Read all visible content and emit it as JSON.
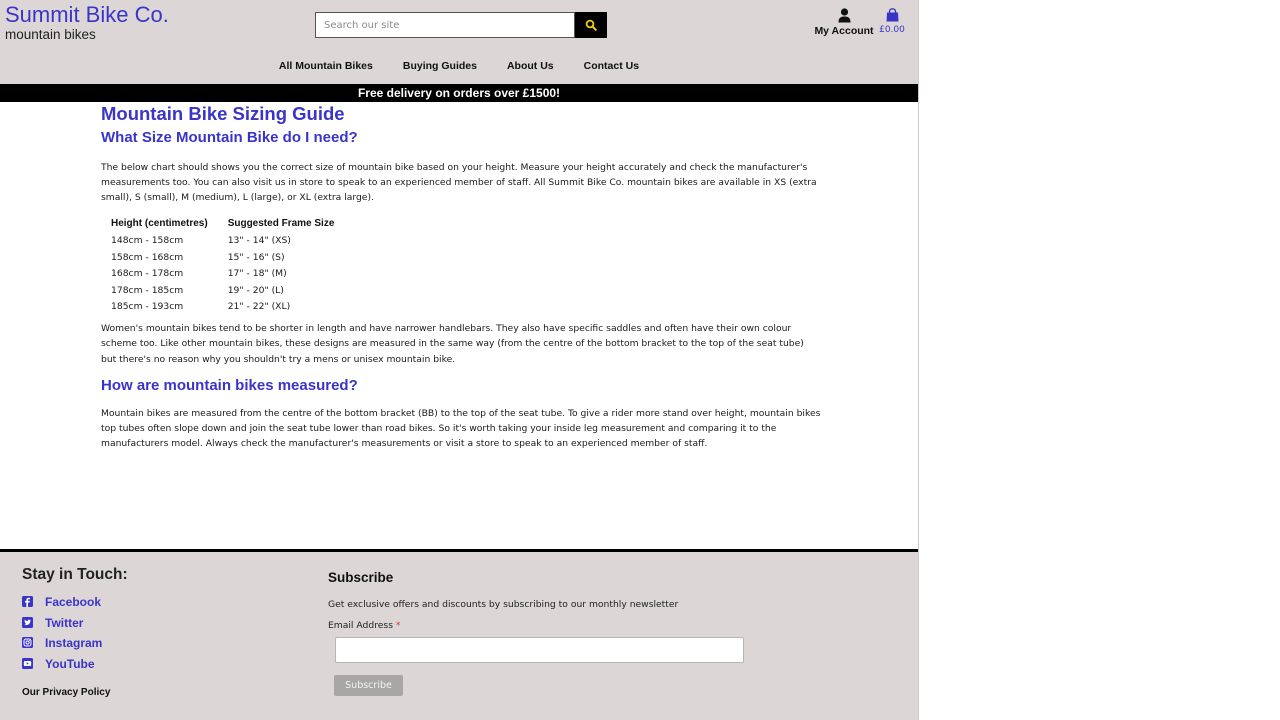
{
  "brand": {
    "name": "Summit Bike Co.",
    "tagline": "mountain bikes"
  },
  "search": {
    "placeholder": "Search our site",
    "button_icon": "search-icon"
  },
  "account": {
    "label": "My Account",
    "icon": "user-icon"
  },
  "cart": {
    "total": "£0.00",
    "icon": "shopping-bag-icon"
  },
  "nav": {
    "items": [
      "All Mountain Bikes",
      "Buying Guides",
      "About Us",
      "Contact Us"
    ]
  },
  "banner": {
    "text": "Free delivery on orders over £1500!"
  },
  "main": {
    "title": "Mountain Bike Sizing Guide",
    "section1_heading": "What Size Mountain Bike do I need?",
    "intro": "The below chart should shows you the correct size of mountain bike based on your height. Measure your height accurately and check the manufacturer's measurements too. You can also visit us in store to speak to an experienced member of staff. All Summit Bike Co. mountain bikes are available in XS (extra small), S (small), M (medium), L (large), or XL (extra large).",
    "table": {
      "headers": [
        "Height (centimetres)",
        "Suggested Frame Size"
      ],
      "rows": [
        [
          "148cm - 158cm",
          "13\" - 14\" (XS)"
        ],
        [
          "158cm - 168cm",
          "15\" - 16\" (S)"
        ],
        [
          "168cm - 178cm",
          "17\" - 18\" (M)"
        ],
        [
          "178cm - 185cm",
          "19\" - 20\" (L)"
        ],
        [
          "185cm - 193cm",
          "21\" - 22\" (XL)"
        ]
      ]
    },
    "womens": "Women's mountain bikes tend to be shorter in length and have narrower handlebars. They also have specific saddles and often have their own colour scheme too. Like other mountain bikes, these designs are measured in the same way (from the centre of the bottom bracket to the top of the seat tube) but there's no reason why you shouldn't try a mens or unisex mountain bike.",
    "section2_heading": "How are mountain bikes measured?",
    "measured": "Mountain bikes are measured from the centre of the bottom bracket (BB) to the top of the seat tube. To give a rider more stand over height, mountain bikes top tubes often slope down and join the seat tube lower than road bikes. So it's worth taking your inside leg measurement and comparing it to the manufacturers model. Always check the manufacturer's measurements or visit a store to speak to an experienced member of staff."
  },
  "footer": {
    "stay_title": "Stay in Touch:",
    "social": [
      {
        "label": "Facebook",
        "icon": "facebook-icon"
      },
      {
        "label": "Twitter",
        "icon": "twitter-icon"
      },
      {
        "label": "Instagram",
        "icon": "instagram-icon"
      },
      {
        "label": "YouTube",
        "icon": "youtube-icon"
      }
    ],
    "privacy": "Our Privacy Policy",
    "subscribe": {
      "title": "Subscribe",
      "description": "Get exclusive offers and discounts by subscribing to our monthly newsletter",
      "email_label": "Email Address",
      "required_mark": "*",
      "button": "Subscribe"
    }
  },
  "colors": {
    "accent": "#3a35c8",
    "header_bg": "#dcd6d6",
    "banner_bg": "#000000"
  }
}
